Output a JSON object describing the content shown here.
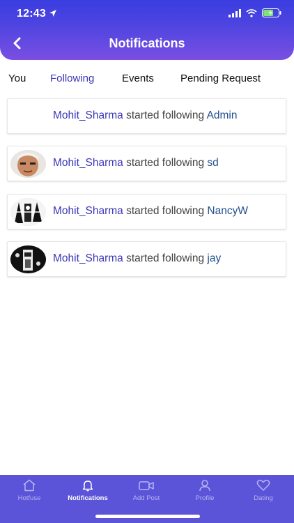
{
  "status_bar": {
    "time": "12:43"
  },
  "header": {
    "title": "Notifications"
  },
  "tabs": [
    {
      "label": "You"
    },
    {
      "label": "Following"
    },
    {
      "label": "Events"
    },
    {
      "label": "Pending Request"
    }
  ],
  "active_tab": "Following",
  "notifications": [
    {
      "user": "Mohit_Sharma",
      "text": " started following ",
      "target": "Admin"
    },
    {
      "user": "Mohit_Sharma",
      "text": " started following ",
      "target": "sd"
    },
    {
      "user": "Mohit_Sharma",
      "text": " started following ",
      "target": "NancyW"
    },
    {
      "user": "Mohit_Sharma",
      "text": " started following ",
      "target": "jay"
    }
  ],
  "bottom_nav": [
    {
      "label": "Hotfuse",
      "icon": "home-icon"
    },
    {
      "label": "Notifications",
      "icon": "bell-icon"
    },
    {
      "label": "Add Post",
      "icon": "video-camera-icon"
    },
    {
      "label": "Profile",
      "icon": "user-icon"
    },
    {
      "label": "Dating",
      "icon": "heart-icon"
    }
  ],
  "active_nav": "Notifications",
  "colors": {
    "header_gradient_top": "#3a3de0",
    "header_gradient_bottom": "#7a4fe2",
    "accent": "#3b36b8",
    "target_link": "#23508e",
    "bottom_nav_bg": "#5b53d8"
  }
}
